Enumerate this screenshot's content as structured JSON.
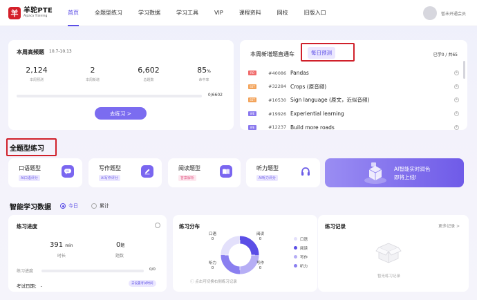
{
  "header": {
    "logo_mark": "羊",
    "logo_title": "羊驼PTE",
    "logo_sub": "Alpaca Training",
    "nav": [
      "首页",
      "全题型练习",
      "学习数据",
      "学习工具",
      "VIP",
      "课程资料",
      "网校",
      "旧版入口"
    ],
    "active_nav": "首页",
    "user_label": "暂未开通会员"
  },
  "weekly": {
    "title": "本周高频题",
    "date_range": "10.7-10.13",
    "stats": [
      {
        "value": "2,124",
        "label": "本周预测"
      },
      {
        "value": "2",
        "label": "本周新增"
      },
      {
        "value": "6,602",
        "label": "总题数"
      },
      {
        "value": "85",
        "unit": "%",
        "label": "命中率"
      }
    ],
    "progress_text": "0/6602",
    "progress_fraction": 0,
    "button_label": "去练习 >"
  },
  "new_questions": {
    "title": "本周新增题直通车",
    "tab_label": "每日预测",
    "count_text": "已学0 / 共65",
    "items": [
      {
        "badge": "RO",
        "badge_color": "#f06c6c",
        "id": "#40086",
        "name": "Pandas"
      },
      {
        "badge": "SST",
        "badge_color": "#f3a35a",
        "id": "#32284",
        "name": "Crops (原音频)"
      },
      {
        "badge": "SST",
        "badge_color": "#f3a35a",
        "id": "#10530",
        "name": "Sign language (原文，近似音频)"
      },
      {
        "badge": "WE",
        "badge_color": "#8a78ee",
        "id": "#19926",
        "name": "Experiential learning"
      },
      {
        "badge": "WE",
        "badge_color": "#8a78ee",
        "id": "#12237",
        "name": "Build more roads"
      }
    ]
  },
  "all_types": {
    "title": "全题型练习",
    "cards": [
      {
        "label": "口语题型",
        "tag": "AI口语评分",
        "icon": "speech-bubble-icon"
      },
      {
        "label": "写作题型",
        "tag": "AI写作评分",
        "icon": "pencil-icon"
      },
      {
        "label": "阅读题型",
        "tag": "答案解析",
        "icon": "book-icon"
      },
      {
        "label": "听力题型",
        "tag": "AI听力评分",
        "icon": "headphones-icon"
      }
    ],
    "banner_line1": "AI智能实时润色",
    "banner_line2": "即将上线!"
  },
  "smart_data": {
    "title": "智能学习数据",
    "radio_options": [
      "今日",
      "累计"
    ],
    "selected": "今日"
  },
  "progress_card": {
    "title": "练习进度",
    "duration_value": "391",
    "duration_unit": "min",
    "duration_label": "时长",
    "count_value": "0",
    "count_unit": "题",
    "count_label": "题数",
    "bar_label": "练习进度",
    "bar_text": "0/0",
    "bar_fraction": 0,
    "exam_label": "考试日期： -",
    "exam_button": "去设置考试时间"
  },
  "distribution": {
    "title": "练习分布",
    "labels": [
      {
        "name": "口语",
        "value": "0"
      },
      {
        "name": "阅读",
        "value": "0"
      },
      {
        "name": "听力",
        "value": "0"
      },
      {
        "name": "写作",
        "value": "0"
      }
    ],
    "legend": [
      "口语",
      "阅读",
      "写作",
      "听力"
    ],
    "legend_colors": [
      "#e3e0fb",
      "#5b4ee6",
      "#b6aef5",
      "#8a7ff0"
    ],
    "tip": "点击可切换右侧练习记录"
  },
  "records": {
    "title": "练习记录",
    "more": "更多记录 >",
    "empty_text": "暂无练习记录"
  }
}
